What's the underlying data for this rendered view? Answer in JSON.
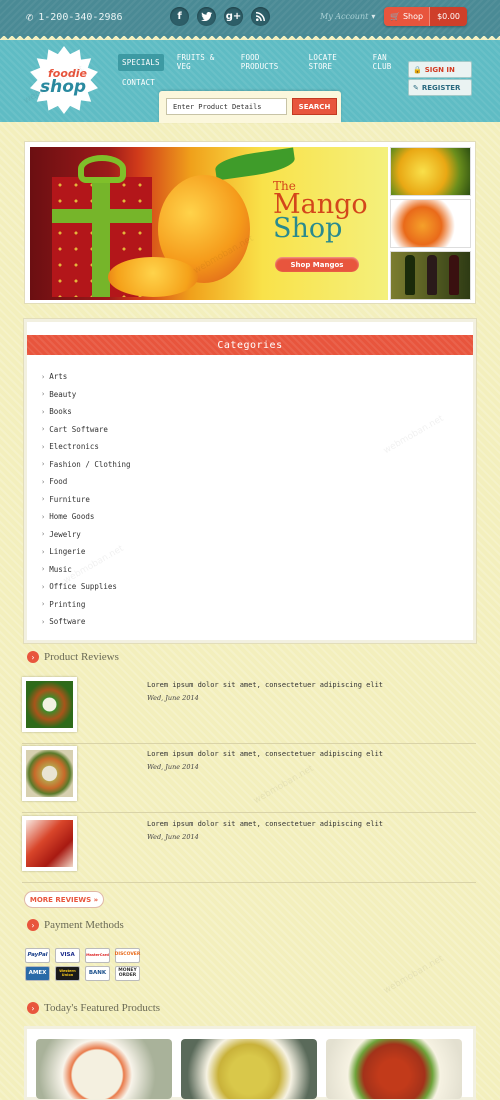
{
  "topbar": {
    "phone": "1-200-340-2986",
    "social": [
      {
        "icon": "facebook-icon",
        "glyph": "f"
      },
      {
        "icon": "twitter-icon",
        "glyph": "t"
      },
      {
        "icon": "google-plus-icon",
        "glyph": "g+"
      },
      {
        "icon": "rss-icon",
        "glyph": ")"
      }
    ],
    "account": "My Account",
    "cart_label": "Shop",
    "cart_total": "$0.00"
  },
  "logo": {
    "line1": "foodie",
    "line2": "shop"
  },
  "nav": {
    "items": [
      "SPECIALS",
      "FRUITS & VEG",
      "FOOD PRODUCTS",
      "LOCATE STORE",
      "FAN CLUB",
      "CONTACT"
    ]
  },
  "auth": {
    "signin": "SIGN IN",
    "register": "REGISTER"
  },
  "search": {
    "placeholder": "Enter Product Details",
    "button": "SEARCH"
  },
  "banner": {
    "the": "The",
    "title1": "Mango",
    "title2": "Shop",
    "button": "Shop Mangos"
  },
  "categories": {
    "title": "Categories",
    "items": [
      "Arts",
      "Beauty",
      "Books",
      "Cart Software",
      "Electronics",
      "Fashion / Clothing",
      "Food",
      "Furniture",
      "Home Goods",
      "Jewelry",
      "Lingerie",
      "Music",
      "Office Supplies",
      "Printing",
      "Software"
    ]
  },
  "reviews": {
    "title": "Product Reviews",
    "items": [
      {
        "text": "Lorem ipsum dolor sit amet, consectetuer adipiscing elit",
        "date": "Wed, June 2014"
      },
      {
        "text": "Lorem ipsum dolor sit amet, consectetuer adipiscing elit",
        "date": "Wed, June 2014"
      },
      {
        "text": "Lorem ipsum dolor sit amet, consectetuer adipiscing elit",
        "date": "Wed, June 2014"
      }
    ],
    "more": "MORE REVIEWS »"
  },
  "payment": {
    "title": "Payment Methods",
    "methods": [
      "PayPal",
      "VISA",
      "MasterCard",
      "DISCOVER",
      "AMEX",
      "Western Union",
      "BANK",
      "MONEY ORDER"
    ]
  },
  "featured": {
    "title": "Today's Featured Products"
  },
  "watermark": "webmoban.net",
  "colors": {
    "accent": "#e8553d",
    "teal": "#5fbcc4",
    "dark_teal": "#4a8a95",
    "background": "#f3efbd"
  }
}
